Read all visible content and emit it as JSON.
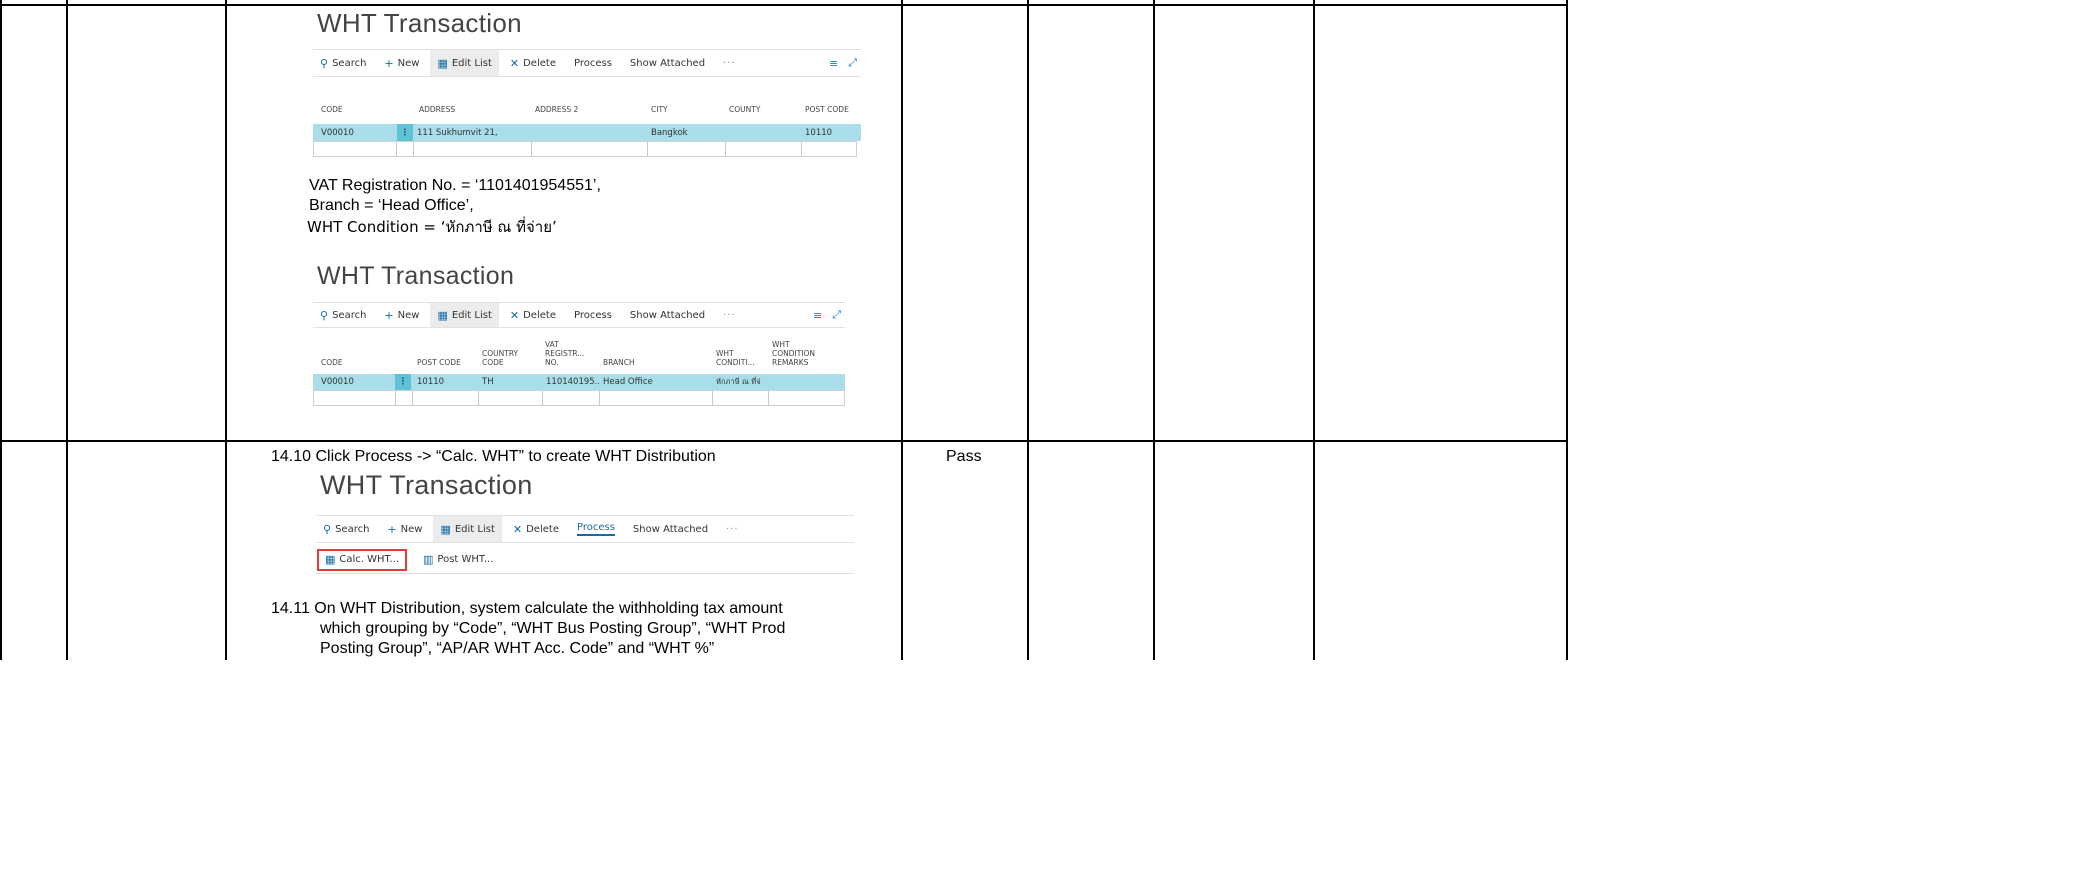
{
  "transaction_block_1": {
    "title": "WHT Transaction",
    "toolbar": {
      "search": "Search",
      "new": "New",
      "edit_list": "Edit List",
      "delete": "Delete",
      "process": "Process",
      "show_attached": "Show Attached",
      "more": "···"
    },
    "columns": [
      "CODE",
      "ADDRESS",
      "ADDRESS 2",
      "CITY",
      "COUNTY",
      "POST CODE"
    ],
    "row": {
      "code": "V00010",
      "address": "111 Sukhumvit 21,",
      "address2": "",
      "city": "Bangkok",
      "county": "",
      "post_code": "10110"
    }
  },
  "conditions": {
    "line1": "VAT Registration No. = ‘1101401954551’,",
    "line2": "Branch = ‘Head Office’,",
    "line3": "WHT Condition = ‘หักภาษี ณ ที่จ่าย’"
  },
  "transaction_block_2": {
    "title": "WHT Transaction",
    "toolbar": {
      "search": "Search",
      "new": "New",
      "edit_list": "Edit List",
      "delete": "Delete",
      "process": "Process",
      "show_attached": "Show Attached",
      "more": "···"
    },
    "columns": {
      "code": "CODE",
      "post_code": "POST CODE",
      "country_code": "COUNTRY CODE",
      "vat_reg": "VAT REGISTR... NO.",
      "branch": "BRANCH",
      "wht_cond": "WHT CONDITI...",
      "wht_remarks": "WHT CONDITION REMARKS"
    },
    "row": {
      "code": "V00010",
      "post_code": "10110",
      "country_code": "TH",
      "vat_reg": "110140195...",
      "branch": "Head Office",
      "wht_cond": "หักภาษี ณ ที่จ่"
    }
  },
  "step_14_10": {
    "text": "14.10 Click Process -> “Calc. WHT” to create WHT Distribution",
    "result": "Pass"
  },
  "transaction_block_3": {
    "title": "WHT Transaction",
    "toolbar": {
      "search": "Search",
      "new": "New",
      "edit_list": "Edit List",
      "delete": "Delete",
      "process": "Process",
      "show_attached": "Show Attached",
      "more": "···"
    },
    "actions": {
      "calc_wht": "Calc. WHT...",
      "post_wht": "Post WHT..."
    }
  },
  "step_14_11": {
    "line1": "14.11 On WHT Distribution, system calculate the withholding tax amount",
    "line2": "which grouping by “Code”, “WHT Bus Posting Group”, “WHT Prod",
    "line3": "Posting Group”, “AP/AR WHT Acc. Code” and “WHT %”"
  },
  "icons": {
    "search": "search-icon",
    "new": "plus-icon",
    "edit_list": "edit-list-icon",
    "delete": "close-icon",
    "list_view": "list-icon",
    "expand": "expand-icon",
    "calc": "calculator-icon",
    "post": "post-icon"
  },
  "colors": {
    "selected_row": "#a8dde9",
    "row_handle": "#5fc2d6",
    "accent": "#0f6aa8",
    "highlight_border": "#e03a3a"
  }
}
